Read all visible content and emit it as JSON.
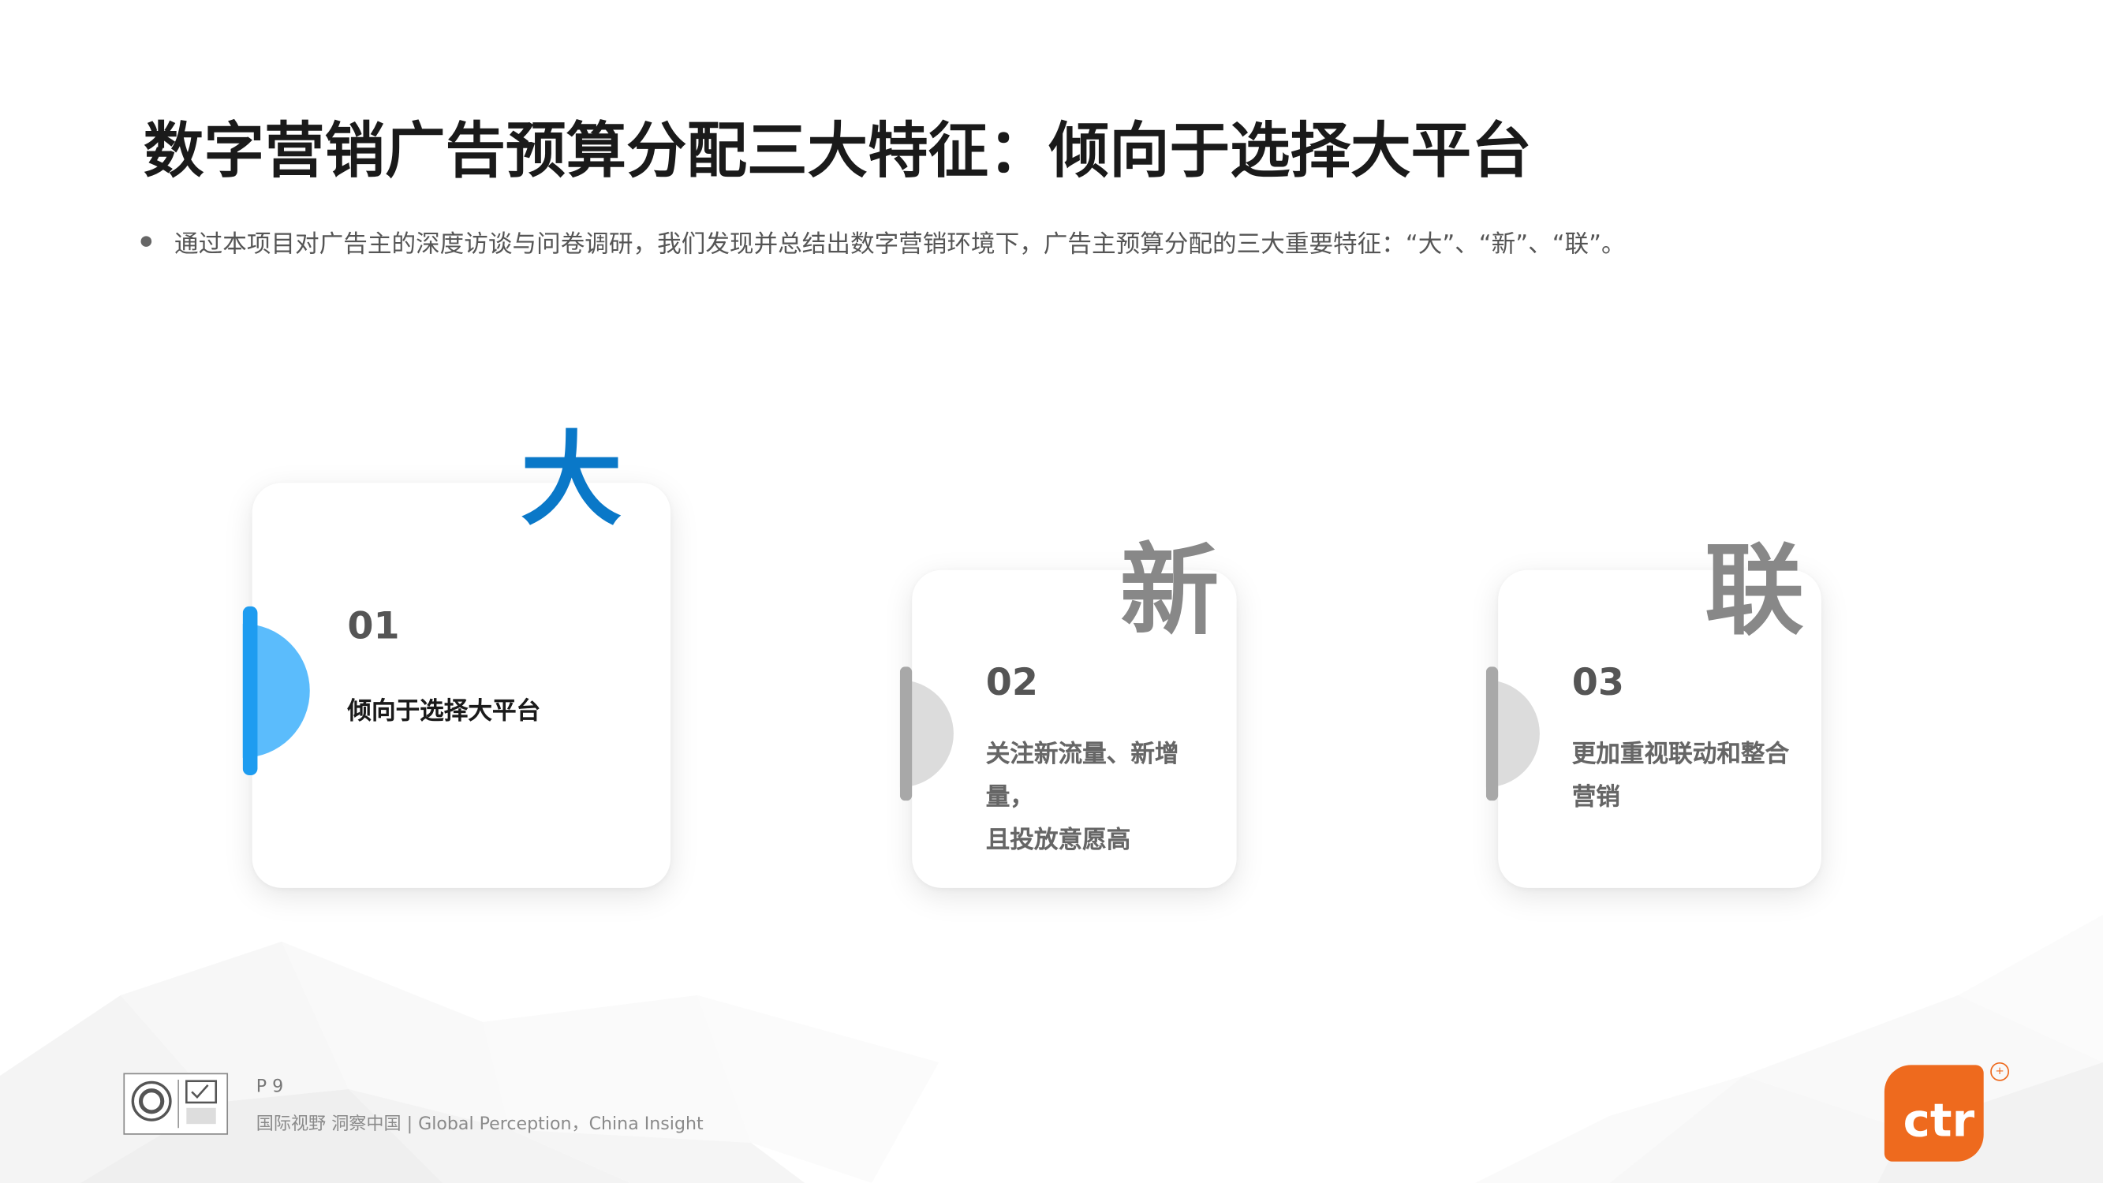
{
  "title": "数字营销广告预算分配三大特征：倾向于选择大平台",
  "bullet": "通过本项目对广告主的深度访谈与问卷调研，我们发现并总结出数字营销环境下，广告主预算分配的三大重要特征：“大”、“新”、“联”。",
  "cards": [
    {
      "char": "大",
      "number": "01",
      "lines": [
        "倾向于选择大平台"
      ],
      "accent": "#0a78c8",
      "half_color": "#5bbcfc",
      "bar_color": "#1e9cf0",
      "text_color": "#1a1a1a"
    },
    {
      "char": "新",
      "number": "02",
      "lines": [
        "关注新流量、新增",
        "量，",
        "且投放意愿高"
      ],
      "accent": "#888888",
      "half_color": "#dcdcdc",
      "bar_color": "#a8a8a8",
      "text_color": "#666666"
    },
    {
      "char": "联",
      "number": "03",
      "lines": [
        "更加重视联动和整合",
        "营销"
      ],
      "accent": "#888888",
      "half_color": "#dcdcdc",
      "bar_color": "#a8a8a8",
      "text_color": "#666666"
    }
  ],
  "footer": {
    "page": "P 9",
    "tagline": "国际视野  洞察中国 |  Global Perception，China Insight"
  },
  "logo": {
    "text": "ctr",
    "brand_color": "#ee6a1e"
  }
}
